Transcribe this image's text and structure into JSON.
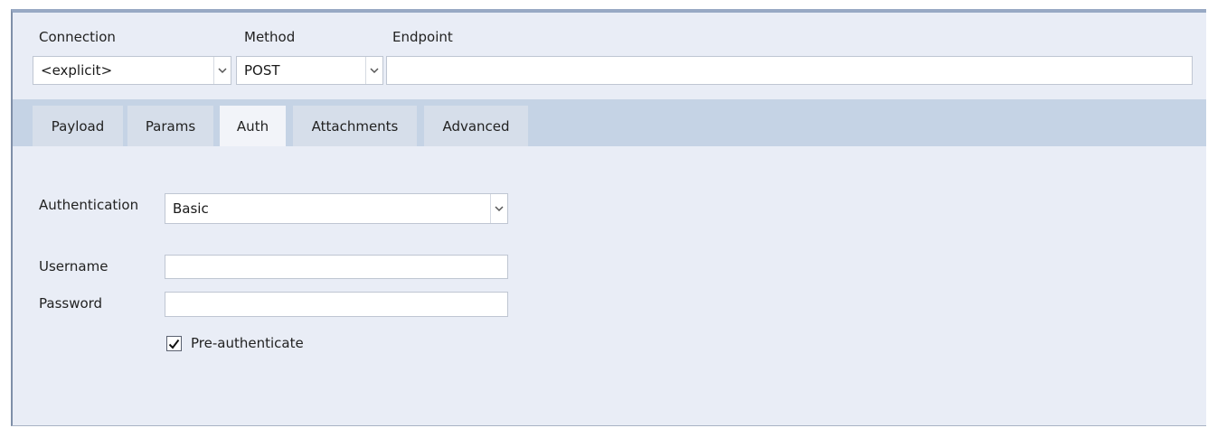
{
  "request": {
    "connection_label": "Connection",
    "connection_value": "<explicit>",
    "method_label": "Method",
    "method_value": "POST",
    "endpoint_label": "Endpoint",
    "endpoint_value": ""
  },
  "tabs": [
    {
      "label": "Payload",
      "active": false
    },
    {
      "label": "Params",
      "active": false
    },
    {
      "label": "Auth",
      "active": true
    },
    {
      "label": "Attachments",
      "active": false
    },
    {
      "label": "Advanced",
      "active": false
    }
  ],
  "auth": {
    "authentication_label": "Authentication",
    "authentication_value": "Basic",
    "username_label": "Username",
    "username_value": "",
    "password_label": "Password",
    "password_value": "",
    "preauth_label": "Pre-authenticate",
    "preauth_checked": true
  },
  "icons": {
    "dropdown": "chevron-down-icon",
    "check": "checkmark-icon"
  },
  "colors": {
    "panel_bg": "#e9edf6",
    "tabstrip_bg": "#c5d3e5",
    "tab_bg": "#d6deea",
    "tab_active_bg": "#f2f4f9"
  }
}
